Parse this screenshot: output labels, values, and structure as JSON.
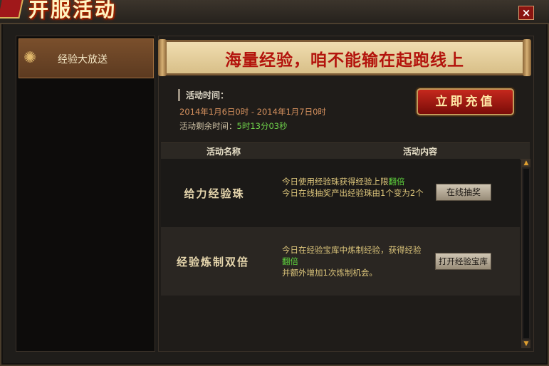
{
  "window": {
    "title": "开服活动",
    "close_glyph": "×"
  },
  "sidebar": {
    "items": [
      {
        "label": "经验大放送"
      }
    ]
  },
  "banner": {
    "text": "海量经验，咱不能输在起跑线上"
  },
  "event": {
    "time_label": "活动时间：",
    "range": "2014年1月6日0时 - 2014年1月7日0时",
    "remaining_label": "活动剩余时间：",
    "remaining_value": "5时13分03秒"
  },
  "recharge_button": {
    "label": "立即充值"
  },
  "table": {
    "headers": [
      "活动名称",
      "活动内容"
    ],
    "rows": [
      {
        "name": "给力经验珠",
        "desc_1a": "今日使用经验珠获得经验上限",
        "desc_1b": "翻倍",
        "desc_2": "今日在线抽奖产出经验珠由1个变为2个",
        "button": "在线抽奖"
      },
      {
        "name": "经验炼制双倍",
        "desc_1": "今日在经验宝库中炼制经验，获得经验",
        "desc_2": "翻倍",
        "desc_3": "并额外增加1次炼制机会。",
        "button": "打开经验宝库"
      }
    ]
  },
  "colors": {
    "accent_red": "#b3140d",
    "highlight_green": "#5ed23d",
    "date_orange": "#d6915e"
  }
}
